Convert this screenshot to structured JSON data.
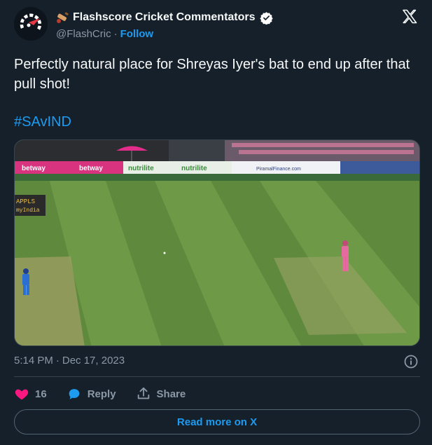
{
  "author": {
    "name": "Flashscore Cricket Commentators",
    "handle": "@FlashCric",
    "separator": "·",
    "follow_label": "Follow"
  },
  "tweet": {
    "text": "Perfectly natural place for Shreyas Iyer's bat to end up after that pull shot!",
    "hashtag": "#SAvIND"
  },
  "media": {
    "board_text_1": "betway",
    "board_text_2": "betway",
    "board_text_3": "nutrilite",
    "board_text_4": "nutrilite",
    "board_text_5": "PiramalFinance.com",
    "side_board_line1": "APPLS",
    "side_board_line2": "myIndia"
  },
  "meta": {
    "time": "5:14 PM",
    "dot": "·",
    "date": "Dec 17, 2023"
  },
  "actions": {
    "likes": "16",
    "reply_label": "Reply",
    "share_label": "Share"
  },
  "read_more_label": "Read more on X",
  "colors": {
    "background": "#15202b",
    "accent": "#1d9bf0",
    "like": "#f91880",
    "muted": "#8b98a5"
  }
}
